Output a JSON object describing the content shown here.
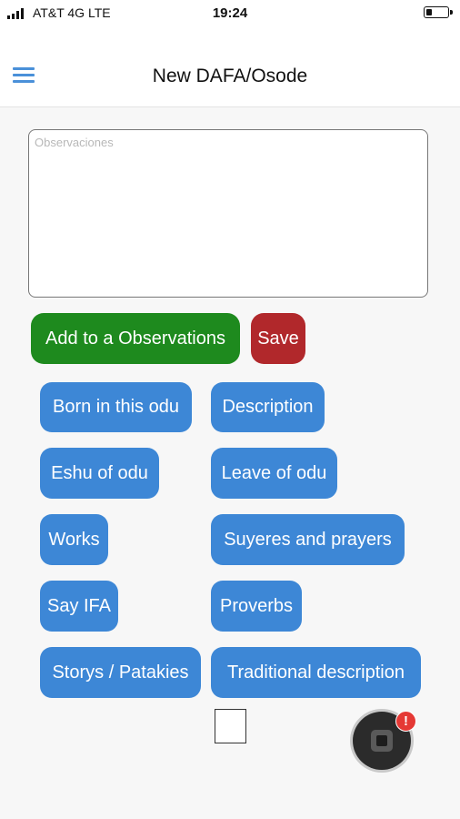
{
  "status_bar": {
    "carrier": "AT&T 4G  LTE",
    "time": "19:24"
  },
  "header": {
    "title": "New DAFA/Osode",
    "menu_icon": "hamburger-menu-icon"
  },
  "observations": {
    "placeholder": "Observaciones",
    "value": ""
  },
  "actions": {
    "add_label": "Add to a Observations",
    "save_label": "Save"
  },
  "sections": [
    "Born in this odu",
    "Description",
    "Eshu of odu",
    "Leave of odu",
    "Works",
    "Suyeres and prayers",
    "Say IFA",
    "Proverbs",
    "Storys / Patakies",
    "Traditional description"
  ],
  "fab": {
    "badge": "!",
    "icon": "stop-square-icon"
  },
  "colors": {
    "accent_blue": "#3d87d6",
    "add_green": "#1e8a1e",
    "save_red": "#b1282b",
    "badge_red": "#e53935"
  }
}
